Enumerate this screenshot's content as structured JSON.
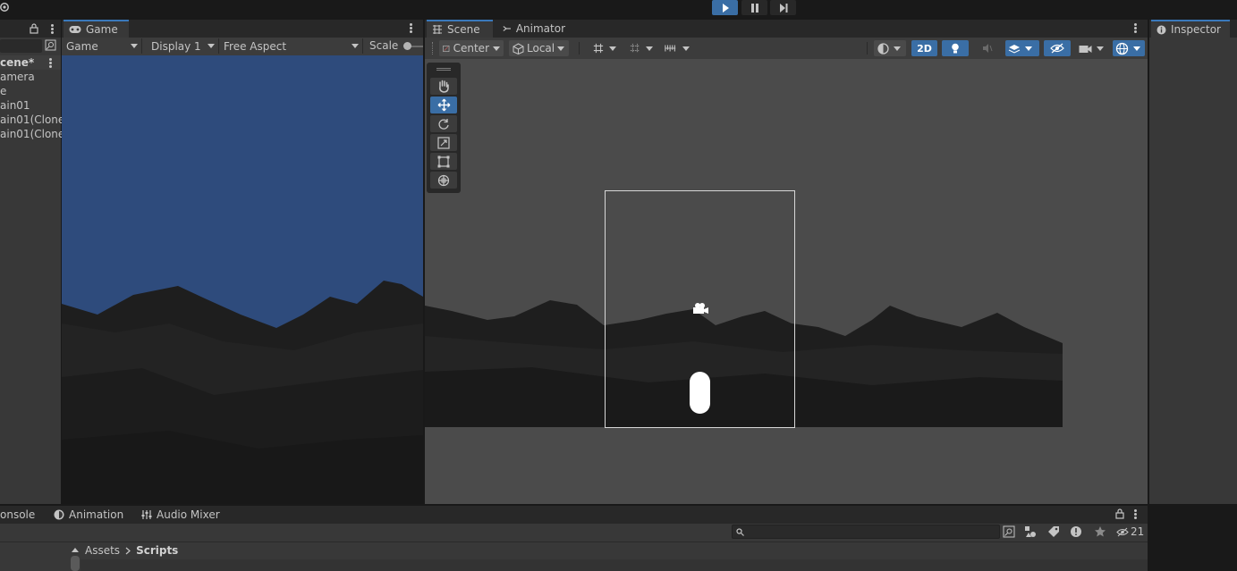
{
  "toolbar": {
    "play_icon": "play-icon",
    "pause_icon": "pause-icon",
    "step_icon": "step-icon"
  },
  "hierarchy": {
    "scene_name": "cene*",
    "items": [
      "amera",
      "e",
      "ain01",
      "ain01(Clone)",
      "ain01(Clone)"
    ]
  },
  "game": {
    "tab_label": "Game",
    "view_mode": "Game",
    "display": "Display 1",
    "aspect": "Free Aspect",
    "scale_label": "Scale",
    "sky_color": "#2e4b7c"
  },
  "scene": {
    "tab_label": "Scene",
    "animator_tab_label": "Animator",
    "pivot": "Center",
    "space": "Local",
    "mode_2d": "2D",
    "background_color": "#4b4b4b"
  },
  "inspector": {
    "tab_label": "Inspector"
  },
  "bottom": {
    "tabs": [
      "onsole",
      "Animation",
      "Audio Mixer"
    ],
    "breadcrumb": [
      "Assets",
      "Scripts"
    ],
    "hidden_count": "21",
    "search_placeholder": ""
  },
  "colors": {
    "accent": "#3a79bb",
    "panel": "#383838",
    "dark": "#282828"
  }
}
